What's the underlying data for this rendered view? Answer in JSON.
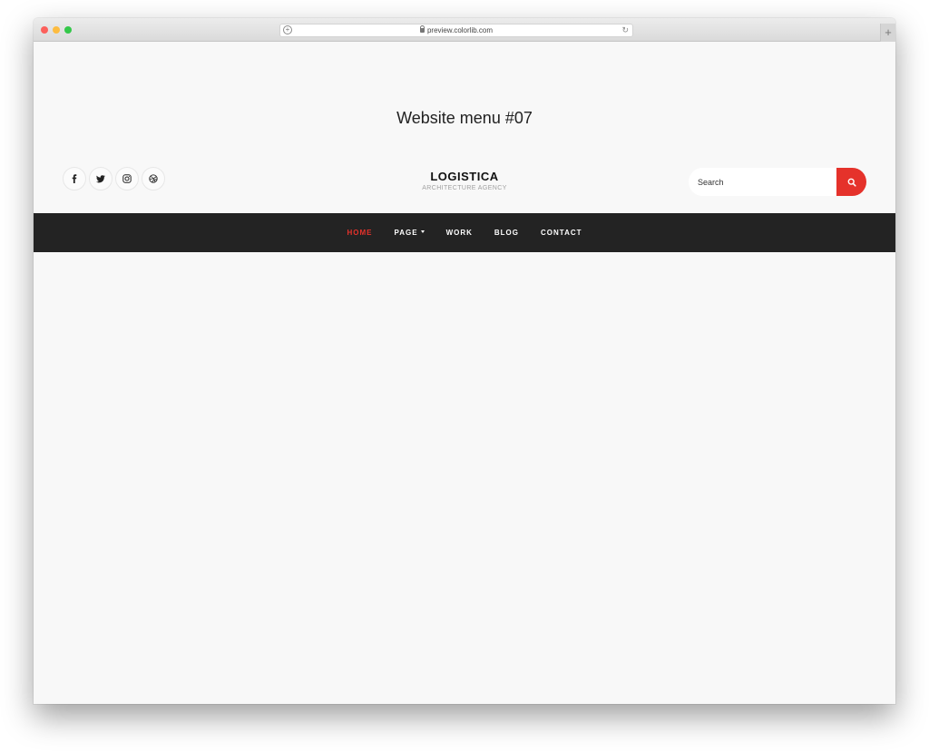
{
  "browser": {
    "url": "preview.colorlib.com",
    "newtab_label": "+"
  },
  "page": {
    "heading": "Website menu #07"
  },
  "social": [
    {
      "icon": "facebook-icon"
    },
    {
      "icon": "twitter-icon"
    },
    {
      "icon": "instagram-icon"
    },
    {
      "icon": "dribbble-icon"
    }
  ],
  "brand": {
    "name": "LOGISTICA",
    "tagline": "ARCHITECTURE AGENCY"
  },
  "search": {
    "placeholder": "Search",
    "button_icon": "search-icon"
  },
  "nav": {
    "items": [
      {
        "label": "HOME",
        "active": true
      },
      {
        "label": "PAGE",
        "dropdown": true
      },
      {
        "label": "WORK"
      },
      {
        "label": "BLOG"
      },
      {
        "label": "CONTACT"
      }
    ]
  },
  "colors": {
    "accent": "#e5322b",
    "navbar": "#232323",
    "background": "#f8f8f8"
  }
}
